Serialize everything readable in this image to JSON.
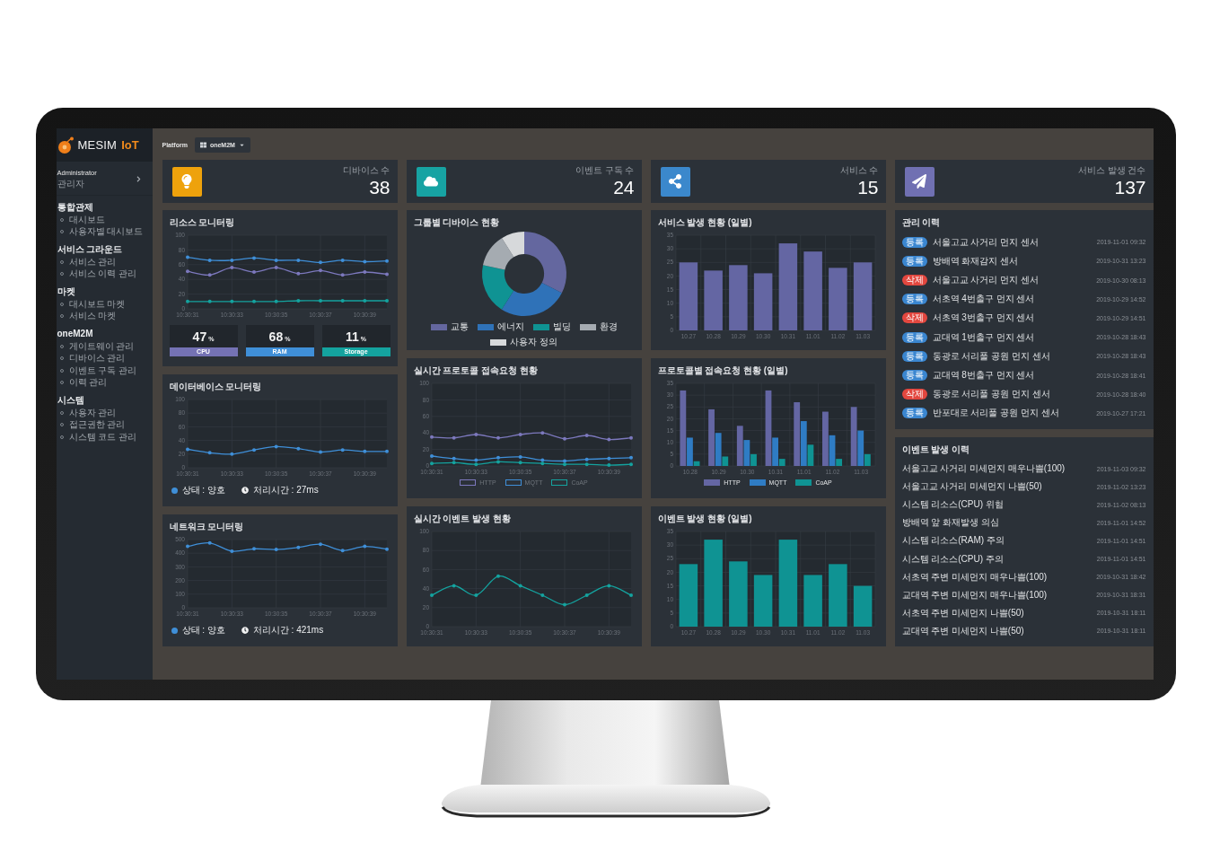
{
  "sidebar": {
    "brand_name": "MESIM",
    "brand_accent": "IoT",
    "user": {
      "name": "Administrator",
      "role": "관리자"
    },
    "sections": [
      {
        "title": "통합관제",
        "items": [
          "대시보드",
          "사용자별 대시보드"
        ]
      },
      {
        "title": "서비스 그라운드",
        "items": [
          "서비스 관리",
          "서비스 이력 관리"
        ]
      },
      {
        "title": "마켓",
        "items": [
          "대시보드 마켓",
          "서비스 마켓"
        ]
      },
      {
        "title": "oneM2M",
        "items": [
          "게이트웨이 관리",
          "디바이스 관리",
          "이벤트 구독 관리",
          "이력 관리"
        ]
      },
      {
        "title": "시스템",
        "items": [
          "사용자 관리",
          "접근권한 관리",
          "시스템 코드 관리"
        ]
      }
    ]
  },
  "top_bar": {
    "label": "Platform",
    "platform": "oneM2M"
  },
  "stats": [
    {
      "label": "디바이스 수",
      "value": "38",
      "color": "#eea20c"
    },
    {
      "label": "이벤트 구독 수",
      "value": "24",
      "color": "#17a3a3"
    },
    {
      "label": "서비스 수",
      "value": "15",
      "color": "#3b88cc"
    },
    {
      "label": "서비스 발생 건수",
      "value": "137",
      "color": "#7070b2"
    }
  ],
  "resource_monitor": {
    "title": "리소스 모니터링",
    "chart_data": {
      "type": "line",
      "categories": [
        "10:30:31",
        null,
        "10:30:33",
        null,
        "10:30:35",
        null,
        "10:30:37",
        null,
        "10:30:39",
        null
      ],
      "ylim": [
        0,
        100
      ],
      "yticks": [
        0,
        20,
        40,
        60,
        80,
        100
      ],
      "grid": true,
      "series": [
        {
          "color": "#3f8fd8",
          "values": [
            70,
            66,
            66,
            69,
            66,
            66,
            63,
            66,
            64,
            65
          ]
        },
        {
          "color": "#7c78bd",
          "values": [
            51,
            46,
            56,
            50,
            56,
            48,
            52,
            46,
            50,
            47
          ]
        },
        {
          "color": "#14a39f",
          "values": [
            10,
            10,
            10,
            10,
            10,
            11,
            11,
            11,
            11,
            11
          ]
        }
      ]
    },
    "gauges": [
      {
        "value": "47",
        "unit": "%",
        "label": "CPU",
        "color": "#7472b4"
      },
      {
        "value": "68",
        "unit": "%",
        "label": "RAM",
        "color": "#3f8fd8"
      },
      {
        "value": "11",
        "unit": "%",
        "label": "Storage",
        "color": "#14a39f"
      }
    ]
  },
  "database_monitor": {
    "title": "데이터베이스 모니터링",
    "chart_data": {
      "type": "line",
      "categories": [
        "10:30:31",
        null,
        "10:30:33",
        null,
        "10:30:35",
        null,
        "10:30:37",
        null,
        "10:30:39",
        null
      ],
      "ylim": [
        0,
        100
      ],
      "yticks": [
        0,
        20,
        40,
        60,
        80,
        100
      ],
      "grid": true,
      "series": [
        {
          "color": "#3f8fd8",
          "values": [
            27,
            22,
            20,
            26,
            31,
            28,
            23,
            26,
            24,
            24
          ]
        }
      ]
    },
    "status": [
      {
        "kind": "state",
        "text": "상태 : 양호"
      },
      {
        "kind": "time",
        "text": "처리시간 : 27ms"
      }
    ]
  },
  "network_monitor": {
    "title": "네트워크 모니터링",
    "chart_data": {
      "type": "line",
      "categories": [
        "10:30:31",
        null,
        "10:30:33",
        null,
        "10:30:35",
        null,
        "10:30:37",
        null,
        "10:30:39",
        null
      ],
      "ylim": [
        0,
        500
      ],
      "yticks": [
        0,
        100,
        200,
        300,
        400,
        500
      ],
      "grid": true,
      "series": [
        {
          "color": "#3f8fd8",
          "values": [
            450,
            475,
            415,
            432,
            427,
            443,
            466,
            420,
            450,
            430
          ]
        }
      ]
    },
    "status": [
      {
        "kind": "state",
        "text": "상태 : 양호"
      },
      {
        "kind": "time",
        "text": "처리시간 : 421ms"
      }
    ]
  },
  "device_groups": {
    "title": "그룹별 디바이스 현황",
    "chart_data": {
      "type": "donut",
      "categories": [
        "교통",
        "에너지",
        "빌딩",
        "환경",
        "사용자 정의"
      ],
      "values": [
        32.5,
        26.5,
        19.3,
        12.8,
        8.9
      ],
      "colors": [
        "#64679f",
        "#2f72b8",
        "#0f9393",
        "#a5abb1",
        "#d7d9db"
      ]
    }
  },
  "realtime_protocol": {
    "title": "실시간 프로토콜 접속요청 현황",
    "chart_data": {
      "type": "line",
      "categories": [
        "10:30:31",
        null,
        "10:30:33",
        null,
        "10:30:35",
        null,
        "10:30:37",
        null,
        "10:30:39",
        null
      ],
      "ylim": [
        0,
        100
      ],
      "yticks": [
        0,
        20,
        40,
        60,
        80,
        100
      ],
      "grid": true,
      "series": [
        {
          "name": "HTTP",
          "color": "#7c78bd",
          "values": [
            35,
            34,
            38,
            34,
            38,
            40,
            33,
            37,
            32,
            34
          ]
        },
        {
          "name": "MQTT",
          "color": "#3f8fd8",
          "values": [
            12,
            9,
            7,
            10,
            11,
            7,
            6,
            8,
            9,
            10
          ]
        },
        {
          "name": "CoAP",
          "color": "#14a39f",
          "values": [
            3,
            4,
            2,
            5,
            4,
            3,
            2,
            2,
            1,
            2
          ]
        }
      ]
    }
  },
  "realtime_events": {
    "title": "실시간 이벤트 발생 현황",
    "chart_data": {
      "type": "line",
      "categories": [
        "10:30:31",
        null,
        "10:30:33",
        null,
        "10:30:35",
        null,
        "10:30:37",
        null,
        "10:30:39",
        null
      ],
      "ylim": [
        0,
        100
      ],
      "yticks": [
        0,
        20,
        40,
        60,
        80,
        100
      ],
      "grid": true,
      "series": [
        {
          "color": "#14a39f",
          "values": [
            33,
            43,
            33,
            53,
            43,
            33,
            23,
            33,
            43,
            33
          ]
        }
      ]
    }
  },
  "daily_services": {
    "title": "서비스 발생 현황 (일별)",
    "chart_data": {
      "type": "bar",
      "categories": [
        "10.27",
        "10.28",
        "10.29",
        "10.30",
        "10.31",
        "11.01",
        "11.02",
        "11.03"
      ],
      "ylim": [
        0,
        35
      ],
      "yticks": [
        0,
        5,
        10,
        15,
        20,
        25,
        30,
        35
      ],
      "grid": true,
      "series": [
        {
          "color": "#6466a3",
          "values": [
            25,
            22,
            24,
            21,
            32,
            29,
            23,
            25
          ]
        }
      ]
    }
  },
  "daily_protocol": {
    "title": "프로토콜별 접속요청 현황 (일별)",
    "chart_data": {
      "type": "bar",
      "categories": [
        "10.28",
        "10.29",
        "10.30",
        "10.31",
        "11.01",
        "11.02",
        "11.03"
      ],
      "ylim": [
        0,
        35
      ],
      "yticks": [
        0,
        5,
        10,
        15,
        20,
        25,
        30,
        35
      ],
      "grid": true,
      "series": [
        {
          "name": "HTTP",
          "color": "#6466a3",
          "values": [
            32,
            24,
            17,
            32,
            27,
            23,
            25
          ]
        },
        {
          "name": "MQTT",
          "color": "#2f7cc4",
          "values": [
            12,
            14,
            11,
            12,
            19,
            13,
            15
          ]
        },
        {
          "name": "CoAP",
          "color": "#0f9393",
          "values": [
            2,
            4,
            5,
            3,
            9,
            3,
            5
          ]
        }
      ]
    }
  },
  "daily_events": {
    "title": "이벤트 발생 현황 (일별)",
    "chart_data": {
      "type": "bar",
      "categories": [
        "10.27",
        "10.28",
        "10.29",
        "10.30",
        "10.31",
        "11.01",
        "11.02",
        "11.03"
      ],
      "ylim": [
        0,
        35
      ],
      "yticks": [
        0,
        5,
        10,
        15,
        20,
        25,
        30,
        35
      ],
      "grid": true,
      "series": [
        {
          "color": "#0f9393",
          "values": [
            23,
            32,
            24,
            19,
            32,
            19,
            23,
            15
          ]
        }
      ]
    }
  },
  "management_history": {
    "title": "관리 이력",
    "items": [
      {
        "action": "등록",
        "color": "#3a86d0",
        "text": "서울고교 사거리 먼지 센서",
        "time": "2019-11-01 09:32"
      },
      {
        "action": "등록",
        "color": "#3a86d0",
        "text": "방배역 화재감지 센서",
        "time": "2019-10-31 13:23"
      },
      {
        "action": "삭제",
        "color": "#e2473f",
        "text": "서울고교 사거리 먼지 센서",
        "time": "2019-10-30 08:13"
      },
      {
        "action": "등록",
        "color": "#3a86d0",
        "text": "서초역 4번출구 먼지 센서",
        "time": "2019-10-29 14:52"
      },
      {
        "action": "삭제",
        "color": "#e2473f",
        "text": "서초역 3번출구 먼지 센서",
        "time": "2019-10-29 14:51"
      },
      {
        "action": "등록",
        "color": "#3a86d0",
        "text": "교대역 1번출구 먼지 센서",
        "time": "2019-10-28 18:43"
      },
      {
        "action": "등록",
        "color": "#3a86d0",
        "text": "동광로 서리풀 공원 먼지 센서",
        "time": "2019-10-28 18:43"
      },
      {
        "action": "등록",
        "color": "#3a86d0",
        "text": "교대역 8번출구 먼지 센서",
        "time": "2019-10-28 18:41"
      },
      {
        "action": "삭제",
        "color": "#e2473f",
        "text": "동광로 서리풀 공원 먼지 센서",
        "time": "2019-10-28 18:40"
      },
      {
        "action": "등록",
        "color": "#3a86d0",
        "text": "반포대로 서리풀 공원 먼지 센서",
        "time": "2019-10-27 17:21"
      }
    ]
  },
  "event_history": {
    "title": "이벤트 발생 이력",
    "items": [
      {
        "text": "서울고교 사거리 미세먼지 매우나쁨(100)",
        "time": "2019-11-03 09:32"
      },
      {
        "text": "서울고교 사거리 미세먼지 나쁨(50)",
        "time": "2019-11-02 13:23"
      },
      {
        "text": "시스템 리소스(CPU) 위험",
        "time": "2019-11-02 08:13"
      },
      {
        "text": "방배역 앞 화재발생 의심",
        "time": "2019-11-01 14:52"
      },
      {
        "text": "시스템 리소스(RAM) 주의",
        "time": "2019-11-01 14:51"
      },
      {
        "text": "시스템 리소스(CPU) 주의",
        "time": "2019-11-01 14:51"
      },
      {
        "text": "서초역 주변 미세먼지 매우나쁨(100)",
        "time": "2019-10-31 18:42"
      },
      {
        "text": "교대역 주변 미세먼지 매우나쁨(100)",
        "time": "2019-10-31 18:31"
      },
      {
        "text": "서초역 주변 미세먼지 나쁨(50)",
        "time": "2019-10-31 18:11"
      },
      {
        "text": "교대역 주변 미세먼지 나쁨(50)",
        "time": "2019-10-31 18:11"
      }
    ]
  }
}
